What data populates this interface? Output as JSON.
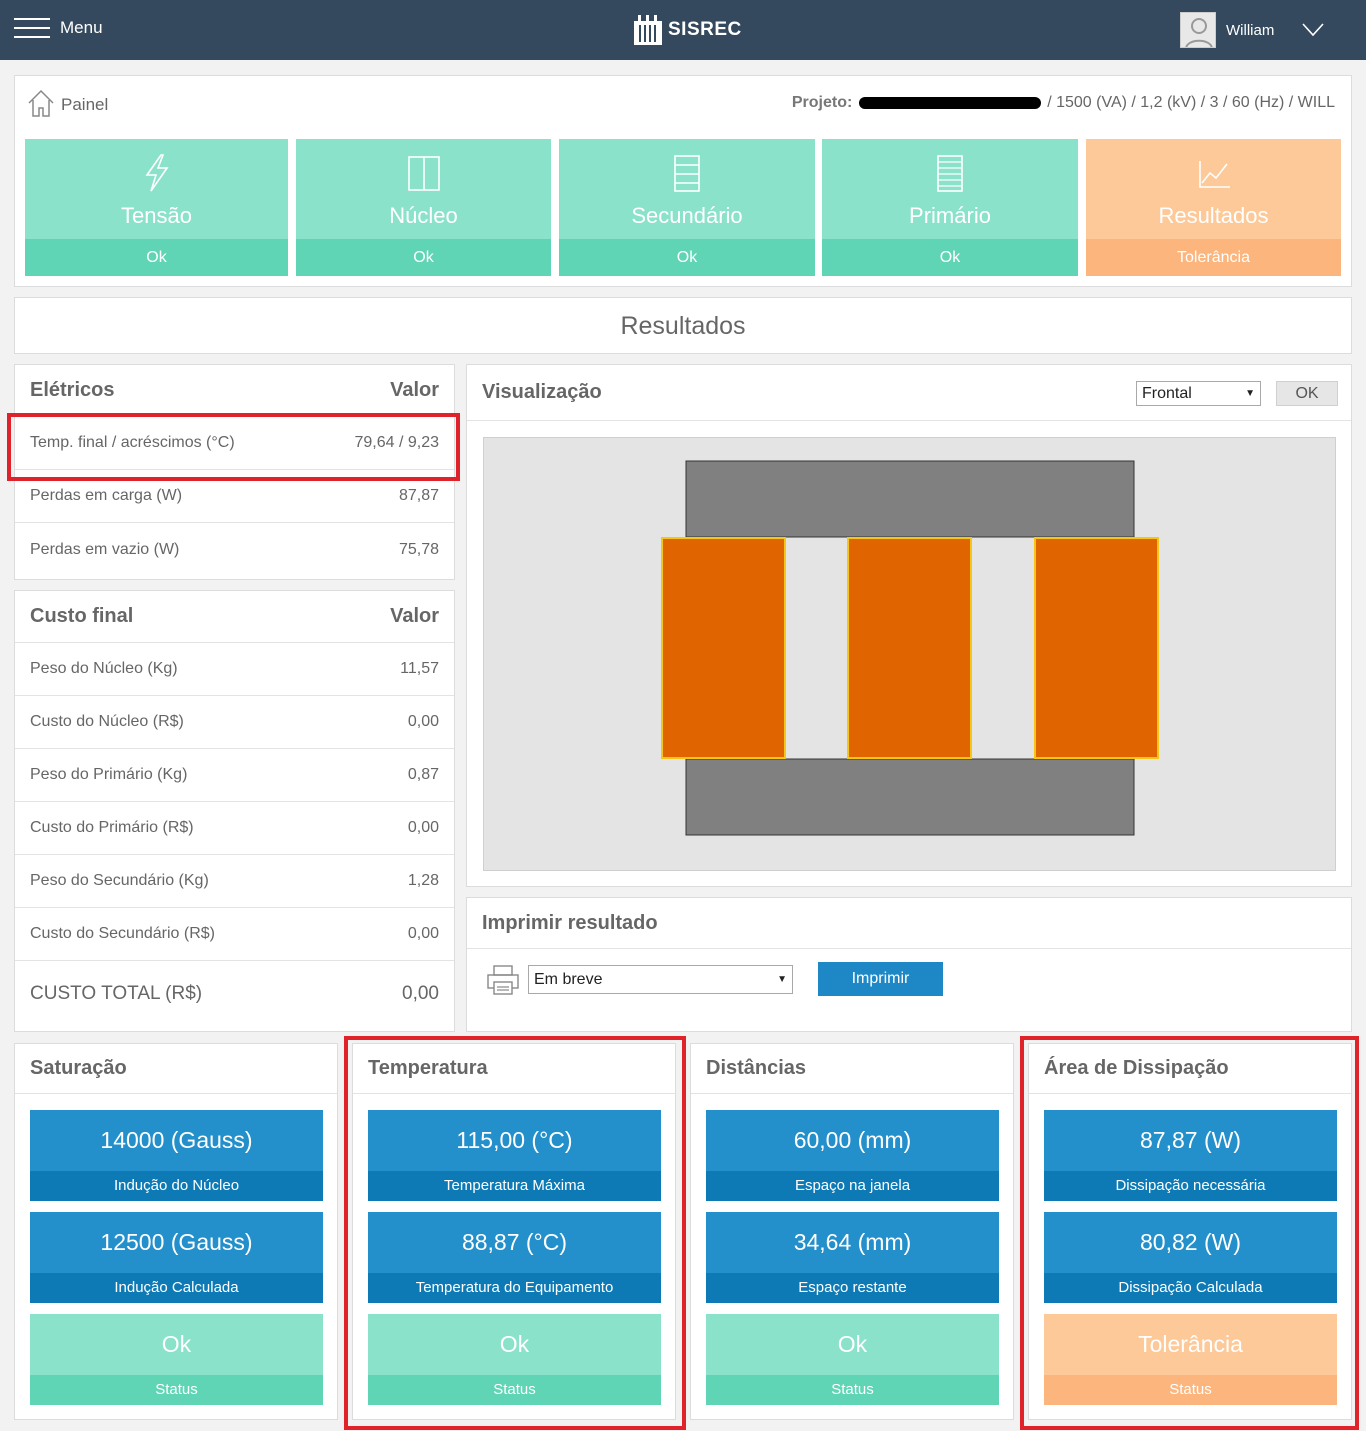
{
  "topbar": {
    "menu_label": "Menu",
    "brand": "SISREC",
    "user_name": "William"
  },
  "breadcrumb": {
    "label": "Painel"
  },
  "project": {
    "prefix": "Projeto:",
    "details": "/ 1500 (VA) / 1,2 (kV) / 3 / 60 (Hz) / WILL"
  },
  "steps": [
    {
      "label": "Tensão",
      "status": "Ok",
      "icon": "lightning-icon"
    },
    {
      "label": "Núcleo",
      "status": "Ok",
      "icon": "core-icon"
    },
    {
      "label": "Secundário",
      "status": "Ok",
      "icon": "winding-icon"
    },
    {
      "label": "Primário",
      "status": "Ok",
      "icon": "winding-icon"
    },
    {
      "label": "Resultados",
      "status": "Tolerância",
      "icon": "chart-line-icon"
    }
  ],
  "page_title": "Resultados",
  "eletricos": {
    "header": "Elétricos",
    "value_header": "Valor",
    "rows": [
      {
        "label": "Temp. final / acréscimos (°C)",
        "value": "79,64 / 9,23"
      },
      {
        "label": "Perdas em carga (W)",
        "value": "87,87"
      },
      {
        "label": "Perdas em vazio (W)",
        "value": "75,78"
      }
    ]
  },
  "custo": {
    "header": "Custo final",
    "value_header": "Valor",
    "rows": [
      {
        "label": "Peso do Núcleo (Kg)",
        "value": "11,57"
      },
      {
        "label": "Custo do Núcleo (R$)",
        "value": "0,00"
      },
      {
        "label": "Peso do Primário (Kg)",
        "value": "0,87"
      },
      {
        "label": "Custo do Primário (R$)",
        "value": "0,00"
      },
      {
        "label": "Peso do Secundário (Kg)",
        "value": "1,28"
      },
      {
        "label": "Custo do Secundário (R$)",
        "value": "0,00"
      }
    ],
    "total_label": "CUSTO TOTAL (R$)",
    "total_value": "0,00"
  },
  "visualizacao": {
    "header": "Visualização",
    "view_selected": "Frontal",
    "ok_label": "OK",
    "colors": {
      "core": "#808080",
      "coil": "#e06400",
      "coil_edge": "#f5c518"
    }
  },
  "imprimir": {
    "header": "Imprimir resultado",
    "select_value": "Em breve",
    "button_label": "Imprimir"
  },
  "cards": [
    {
      "header": "Saturação",
      "tiles": [
        {
          "value": "14000 (Gauss)",
          "label": "Indução do Núcleo",
          "kind": "info"
        },
        {
          "value": "12500 (Gauss)",
          "label": "Indução Calculada",
          "kind": "info"
        },
        {
          "value": "Ok",
          "label": "Status",
          "kind": "ok"
        }
      ]
    },
    {
      "header": "Temperatura",
      "tiles": [
        {
          "value": "115,00 (°C)",
          "label": "Temperatura Máxima",
          "kind": "info"
        },
        {
          "value": "88,87 (°C)",
          "label": "Temperatura do Equipamento",
          "kind": "info"
        },
        {
          "value": "Ok",
          "label": "Status",
          "kind": "ok"
        }
      ]
    },
    {
      "header": "Distâncias",
      "tiles": [
        {
          "value": "60,00 (mm)",
          "label": "Espaço na janela",
          "kind": "info"
        },
        {
          "value": "34,64 (mm)",
          "label": "Espaço restante",
          "kind": "info"
        },
        {
          "value": "Ok",
          "label": "Status",
          "kind": "ok"
        }
      ]
    },
    {
      "header": "Área de Dissipação",
      "tiles": [
        {
          "value": "87,87 (W)",
          "label": "Dissipação necessária",
          "kind": "info"
        },
        {
          "value": "80,82 (W)",
          "label": "Dissipação Calculada",
          "kind": "info"
        },
        {
          "value": "Tolerância",
          "label": "Status",
          "kind": "warn"
        }
      ]
    }
  ],
  "colors": {
    "topbar": "#34495e",
    "ok": "#8ae2ca",
    "ok_dark": "#5fd5b5",
    "warn": "#fdc998",
    "warn_dark": "#fcb57d",
    "info": "#238fcb",
    "info_dark": "#0d7ab5",
    "highlight": "#e0222b"
  }
}
